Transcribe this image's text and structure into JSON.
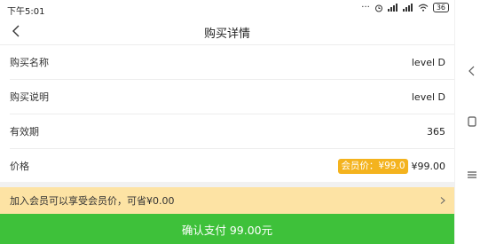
{
  "status_bar": {
    "time": "下午5:01",
    "icons": [
      "dots-icon",
      "alarm-icon",
      "signal-icon",
      "signal-icon",
      "wifi-icon"
    ],
    "battery": "36"
  },
  "header": {
    "title": "购买详情"
  },
  "details": [
    {
      "label": "购买名称",
      "value": "level D"
    },
    {
      "label": "购买说明",
      "value": "level D"
    },
    {
      "label": "有效期",
      "value": "365"
    }
  ],
  "price_row": {
    "label": "价格",
    "member_badge": "会员价：¥99.0",
    "price": "¥99.00"
  },
  "membership_banner": {
    "text": "加入会员可以享受会员价，可省¥0.00"
  },
  "pay_button": {
    "label": "确认支付 99.00元"
  },
  "colors": {
    "pay_button": "#3ec13a",
    "member_badge": "#f4b31e",
    "banner_bg": "#fde3a4"
  }
}
